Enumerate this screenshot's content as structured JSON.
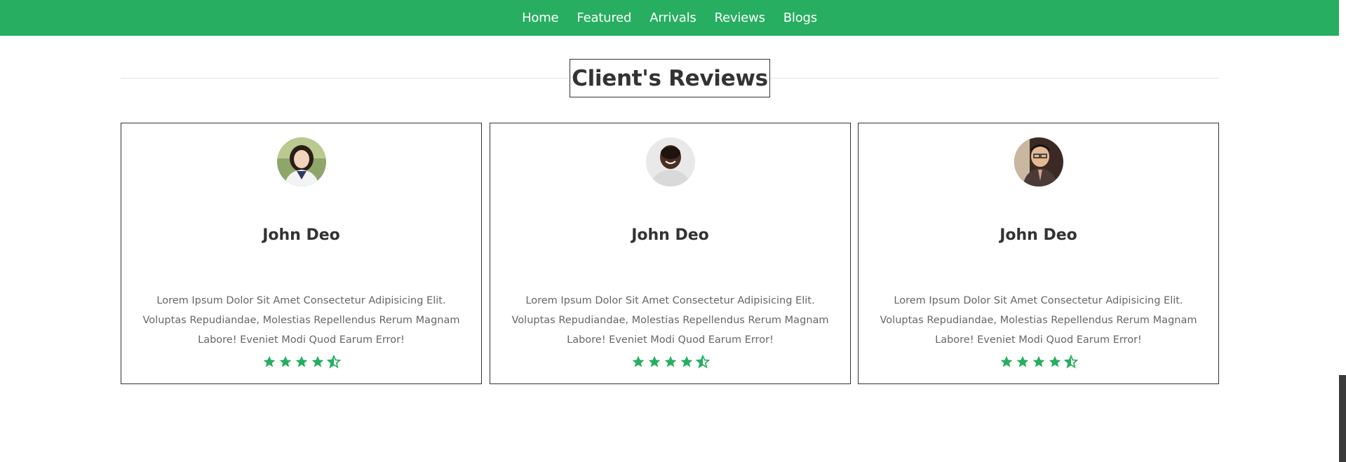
{
  "nav": {
    "items": [
      {
        "label": "Home"
      },
      {
        "label": "Featured"
      },
      {
        "label": "Arrivals"
      },
      {
        "label": "Reviews"
      },
      {
        "label": "Blogs"
      }
    ]
  },
  "section": {
    "heading": "Client's Reviews"
  },
  "reviews": [
    {
      "name": "John Deo",
      "text": "Lorem Ipsum Dolor Sit Amet Consectetur Adipisicing Elit. Voluptas Repudiandae, Molestias Repellendus Rerum Magnam Labore! Eveniet Modi Quod Earum Error!",
      "rating": 4.5,
      "avatar": "young-woman-photo"
    },
    {
      "name": "John Deo",
      "text": "Lorem Ipsum Dolor Sit Amet Consectetur Adipisicing Elit. Voluptas Repudiandae, Molestias Repellendus Rerum Magnam Labore! Eveniet Modi Quod Earum Error!",
      "rating": 4.5,
      "avatar": "smiling-man-photo"
    },
    {
      "name": "John Deo",
      "text": "Lorem Ipsum Dolor Sit Amet Consectetur Adipisicing Elit. Voluptas Repudiandae, Molestias Repellendus Rerum Magnam Labore! Eveniet Modi Quod Earum Error!",
      "rating": 4.5,
      "avatar": "man-with-glasses-photo"
    }
  ],
  "colors": {
    "brand": "#27ae60",
    "text": "#333333",
    "muted": "#666666"
  }
}
